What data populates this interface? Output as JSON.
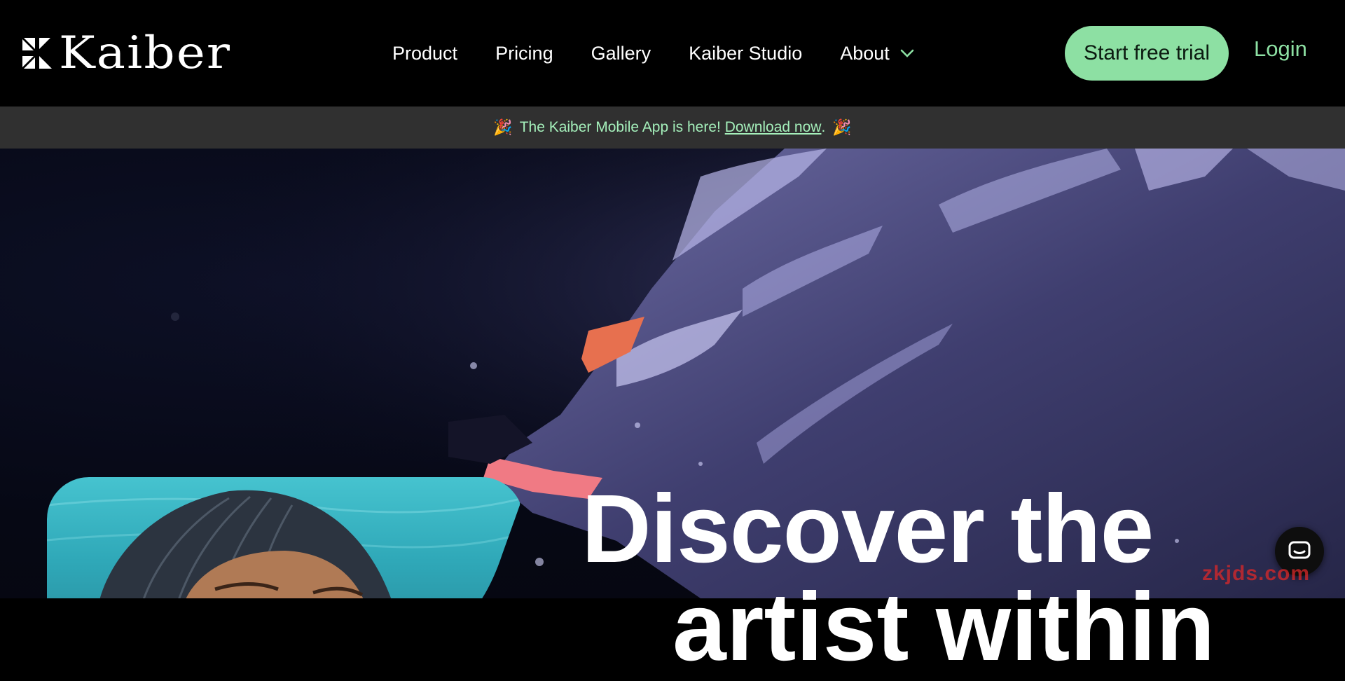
{
  "brand": {
    "name": "Kaiber",
    "accent": "#8de0a3"
  },
  "nav": {
    "items": [
      {
        "label": "Product"
      },
      {
        "label": "Pricing"
      },
      {
        "label": "Gallery"
      },
      {
        "label": "Kaiber Studio"
      },
      {
        "label": "About",
        "icon": "chevron-down-icon"
      }
    ]
  },
  "header": {
    "cta_label": "Start free trial",
    "login_label": "Login"
  },
  "banner": {
    "icon": "party-popper-icon",
    "text": "The Kaiber Mobile App is here!",
    "link_label": "Download now",
    "suffix": "."
  },
  "hero": {
    "title_line1": "Discover the",
    "title_line2": "artist within"
  },
  "chat": {
    "icon": "chat-icon"
  },
  "watermark": "zkjds.com"
}
